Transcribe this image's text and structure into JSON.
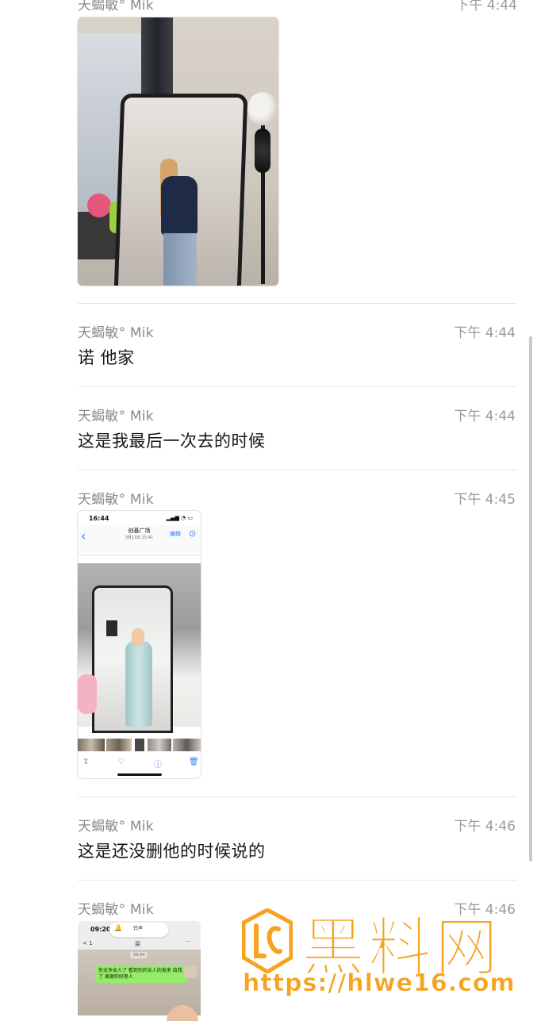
{
  "messages": [
    {
      "sender": "天蝎敏° Mik",
      "time": "下午 4:44",
      "type": "image"
    },
    {
      "sender": "天蝎敏° Mik",
      "time": "下午 4:44",
      "type": "text",
      "text": "诺 他家"
    },
    {
      "sender": "天蝎敏° Mik",
      "time": "下午 4:44",
      "type": "text",
      "text": "这是我最后一次去的时候"
    },
    {
      "sender": "天蝎敏° Mik",
      "time": "下午 4:45",
      "type": "image"
    },
    {
      "sender": "天蝎敏° Mik",
      "time": "下午 4:46",
      "type": "text",
      "text": "这是还没删他的时候说的"
    },
    {
      "sender": "天蝎敏° Mik",
      "time": "下午 4:46",
      "type": "image"
    }
  ],
  "screenshot_album": {
    "status_time": "16:44",
    "status_icons": "▂▄▆ ◔ ▭",
    "title": "创基广场",
    "subtitle": "3月13日 15:41",
    "edit": "编辑",
    "back_icon": "‹",
    "more_icon": "⊙"
  },
  "screenshot_chat": {
    "status_time": "09:20",
    "pill_text": "铃声",
    "nav_back": "< 1",
    "nav_title": "梁",
    "nav_more": "···",
    "date": "09:04",
    "bubble_text": "你太多女人了 看到别的女人的发来 给我了 谢谢你好男人"
  },
  "watermark": {
    "brand": "黑料网",
    "url": "https://hlwe16.com",
    "color": "#f6a31f"
  }
}
